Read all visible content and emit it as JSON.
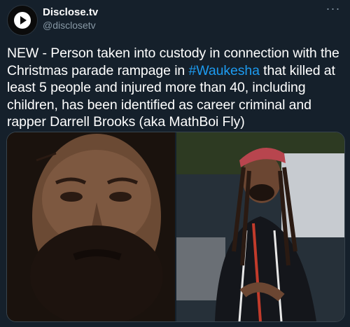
{
  "account": {
    "name": "Disclose.tv",
    "handle": "@disclosetv",
    "avatar_icon": "play-circle-icon"
  },
  "more_icon": "more-dots-icon",
  "tweet": {
    "text_before": "NEW - Person taken into custody in connection with the Christmas parade rampage in ",
    "hashtag": "#Waukesha",
    "text_after": " that killed at least 5 people and injured more than 40, including children, has been identified as career criminal and rapper Darrell Brooks (aka MathBoi Fly)"
  },
  "colors": {
    "background": "#15202b",
    "text": "#ffffff",
    "secondary": "#8899a6",
    "link": "#1d9bf0"
  }
}
